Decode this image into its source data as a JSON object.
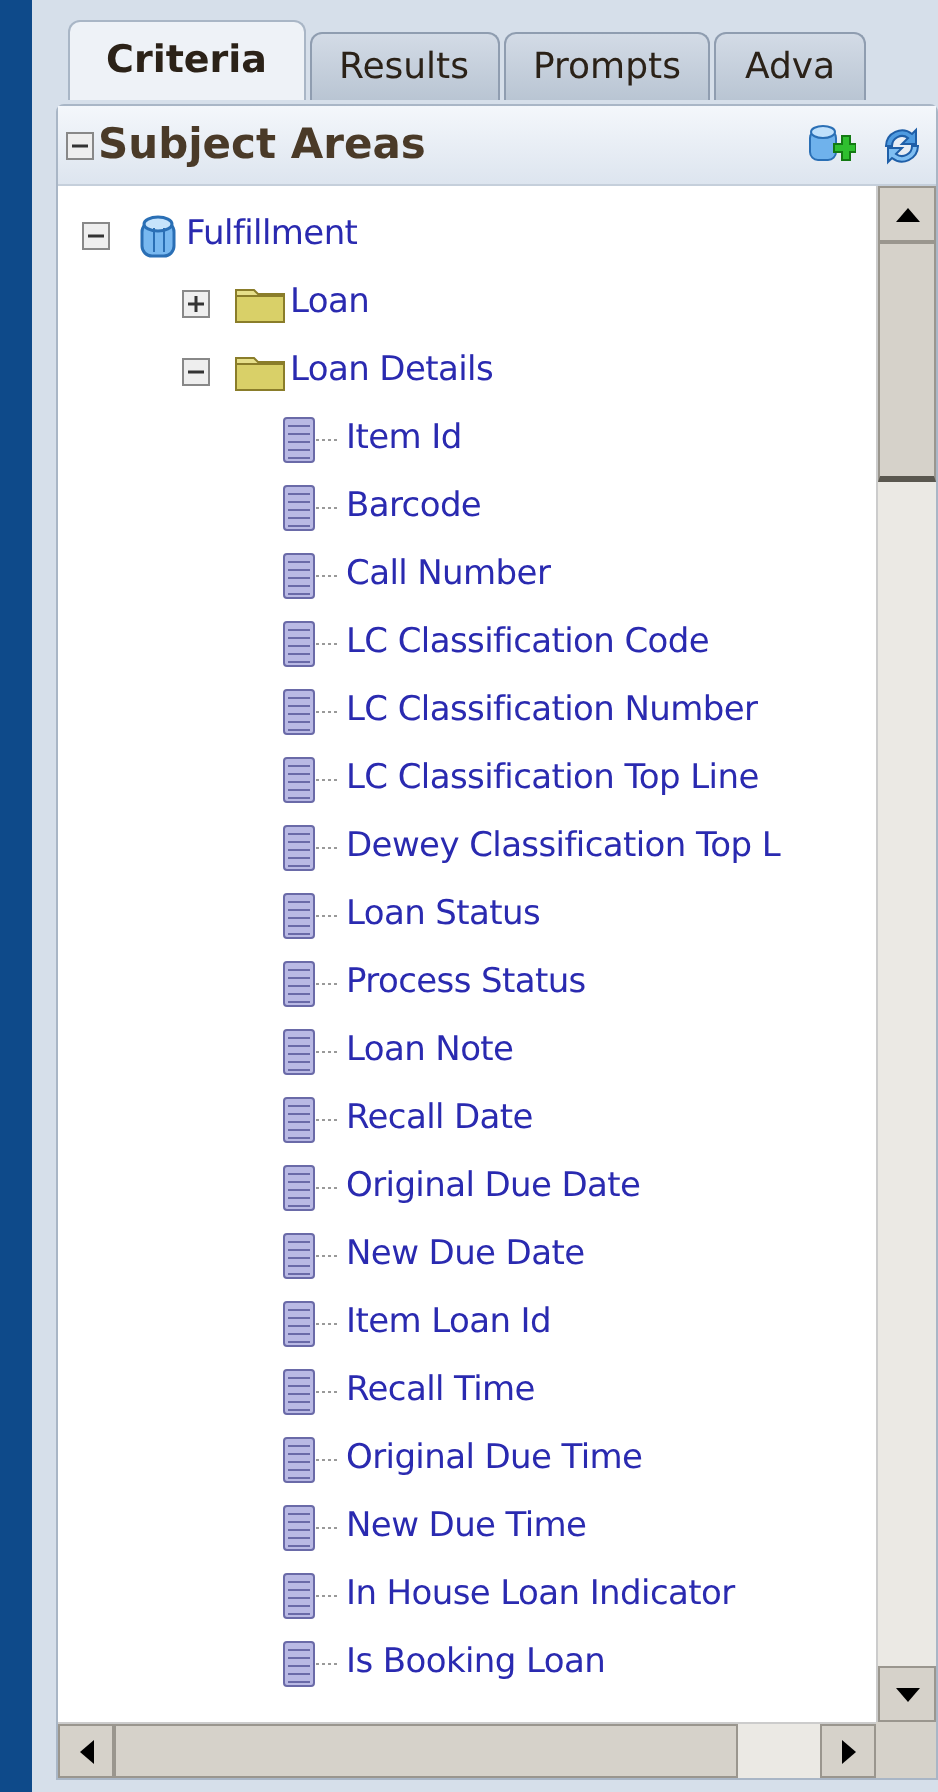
{
  "tabs": [
    {
      "label": "Criteria",
      "selected": true
    },
    {
      "label": "Results",
      "selected": false
    },
    {
      "label": "Prompts",
      "selected": false
    },
    {
      "label": "Adva",
      "selected": false
    }
  ],
  "panel": {
    "title": "Subject Areas",
    "expanded": true
  },
  "tree": [
    {
      "label": "Fulfillment",
      "kind": "subject_area",
      "expanded": true,
      "children": [
        {
          "label": "Loan",
          "kind": "folder",
          "expanded": false
        },
        {
          "label": "Loan Details",
          "kind": "folder",
          "expanded": true,
          "children": [
            {
              "label": "Item Id",
              "kind": "column"
            },
            {
              "label": "Barcode",
              "kind": "column"
            },
            {
              "label": "Call Number",
              "kind": "column"
            },
            {
              "label": "LC Classification Code",
              "kind": "column"
            },
            {
              "label": "LC Classification Number",
              "kind": "column"
            },
            {
              "label": "LC Classification Top Line",
              "kind": "column"
            },
            {
              "label": "Dewey Classification Top L",
              "kind": "column"
            },
            {
              "label": "Loan Status",
              "kind": "column"
            },
            {
              "label": "Process Status",
              "kind": "column"
            },
            {
              "label": "Loan Note",
              "kind": "column"
            },
            {
              "label": "Recall Date",
              "kind": "column"
            },
            {
              "label": "Original Due Date",
              "kind": "column"
            },
            {
              "label": "New Due Date",
              "kind": "column"
            },
            {
              "label": "Item Loan Id",
              "kind": "column"
            },
            {
              "label": "Recall Time",
              "kind": "column"
            },
            {
              "label": "Original Due Time",
              "kind": "column"
            },
            {
              "label": "New Due Time",
              "kind": "column"
            },
            {
              "label": "In House Loan Indicator",
              "kind": "column"
            },
            {
              "label": "Is Booking Loan",
              "kind": "column"
            }
          ]
        }
      ]
    }
  ]
}
